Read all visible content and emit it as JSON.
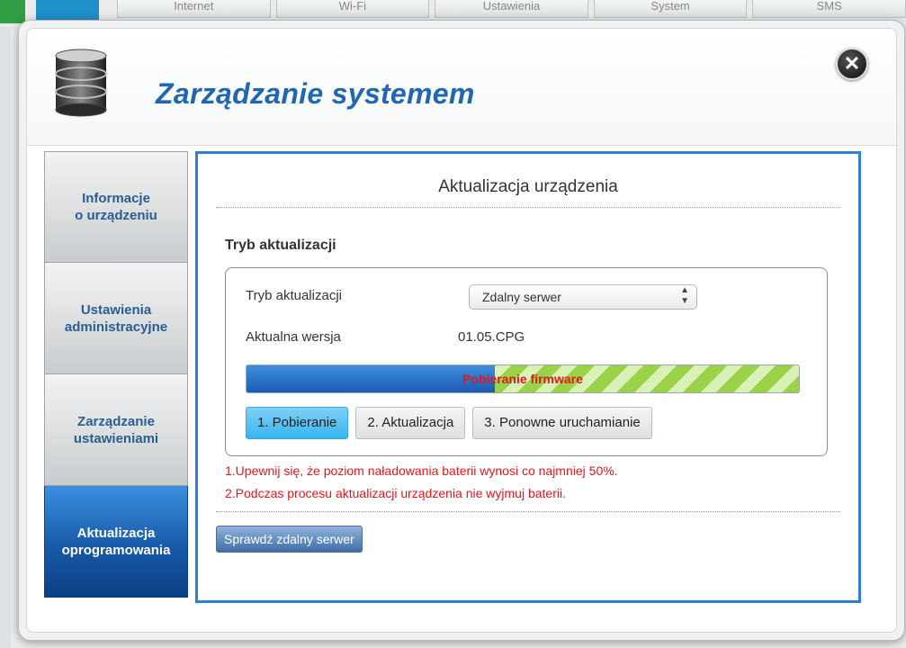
{
  "background_nav": [
    "Internet",
    "Wi-Fi",
    "Ustawienia",
    "System",
    "SMS"
  ],
  "modal": {
    "title": "Zarządzanie systemem",
    "close_icon": "close-icon"
  },
  "sidebar": {
    "items": [
      {
        "label_line1": "Informacje",
        "label_line2": "o urządzeniu",
        "active": false
      },
      {
        "label_line1": "Ustawienia",
        "label_line2": "administracyjne",
        "active": false
      },
      {
        "label_line1": "Zarządzanie",
        "label_line2": "ustawieniami",
        "active": false
      },
      {
        "label_line1": "Aktualizacja",
        "label_line2": "oprogramowania",
        "active": true
      }
    ]
  },
  "content": {
    "title": "Aktualizacja urządzenia",
    "section_title": "Tryb aktualizacji",
    "mode_label": "Tryb aktualizacji",
    "mode_value": "Zdalny serwer",
    "version_label": "Aktualna wersja",
    "version_value": "01.05.CPG",
    "progress": {
      "label": "Pobieranie firmware",
      "fraction": 0.45
    },
    "steps": [
      {
        "label": "1. Pobieranie",
        "active": true
      },
      {
        "label": "2. Aktualizacja",
        "active": false
      },
      {
        "label": "3. Ponowne uruchamianie",
        "active": false
      }
    ],
    "notes": [
      "1.Upewnij się, że poziom naładowania baterii wynosi co najmniej 50%.",
      "2.Podczas procesu aktualizacji urządzenia nie wyjmuj baterii."
    ],
    "check_button": "Sprawdź zdalny serwer"
  },
  "colors": {
    "accent": "#1f67b0",
    "panel_border": "#2f7fd6",
    "warning": "#e4161b",
    "progress_fill": "#1c5ab2",
    "progress_stripe": "#9ad34a"
  }
}
